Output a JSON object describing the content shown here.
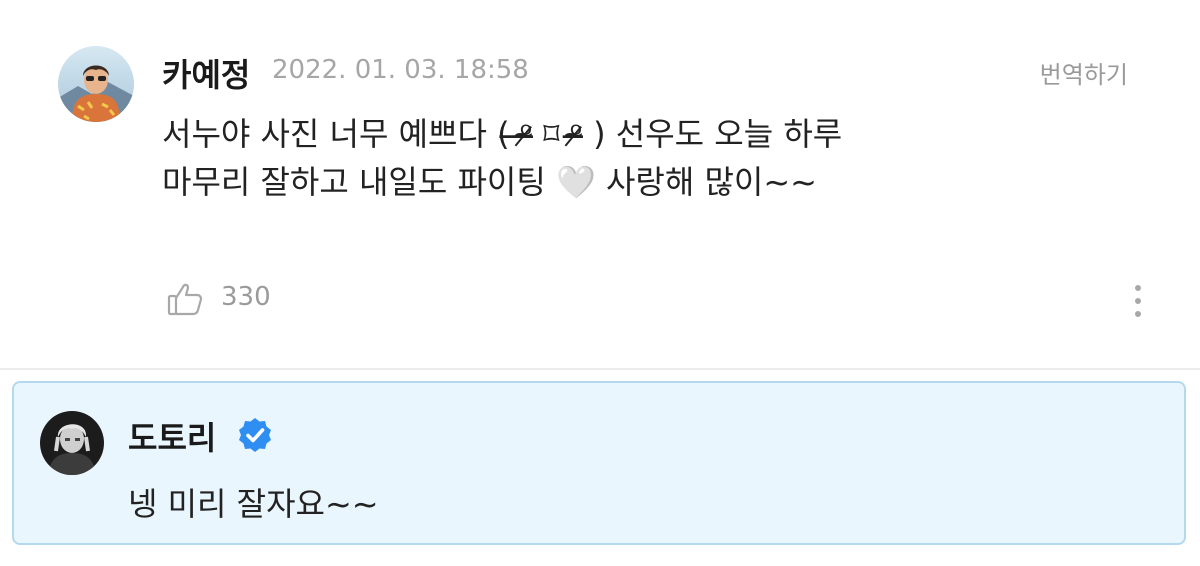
{
  "comment": {
    "author": "카예정",
    "timestamp": "2022. 01. 03. 18:58",
    "translate_label": "번역하기",
    "text_line1": "서누야 사진 너무 예쁘다 ( ̶̶ᵒ̴̶̷ ⌑ ᵒ̴̶̷ ) 선우도 오늘 하루",
    "text_line2": "마무리 잘하고 내일도 파이팅 🤍 사랑해 많이~~",
    "like_count": "330",
    "like_icon": "thumbs-up-icon",
    "more_icon": "vertical-dots-icon"
  },
  "reply": {
    "author": "도토리",
    "verified_icon": "verified-badge-icon",
    "text": "넹 미리 잘자요~~",
    "background_color": "#eaf6fd",
    "border_color": "#b4d8ee"
  },
  "colors": {
    "verified_blue": "#2f8ef2",
    "muted_text": "#9a9a9a"
  }
}
